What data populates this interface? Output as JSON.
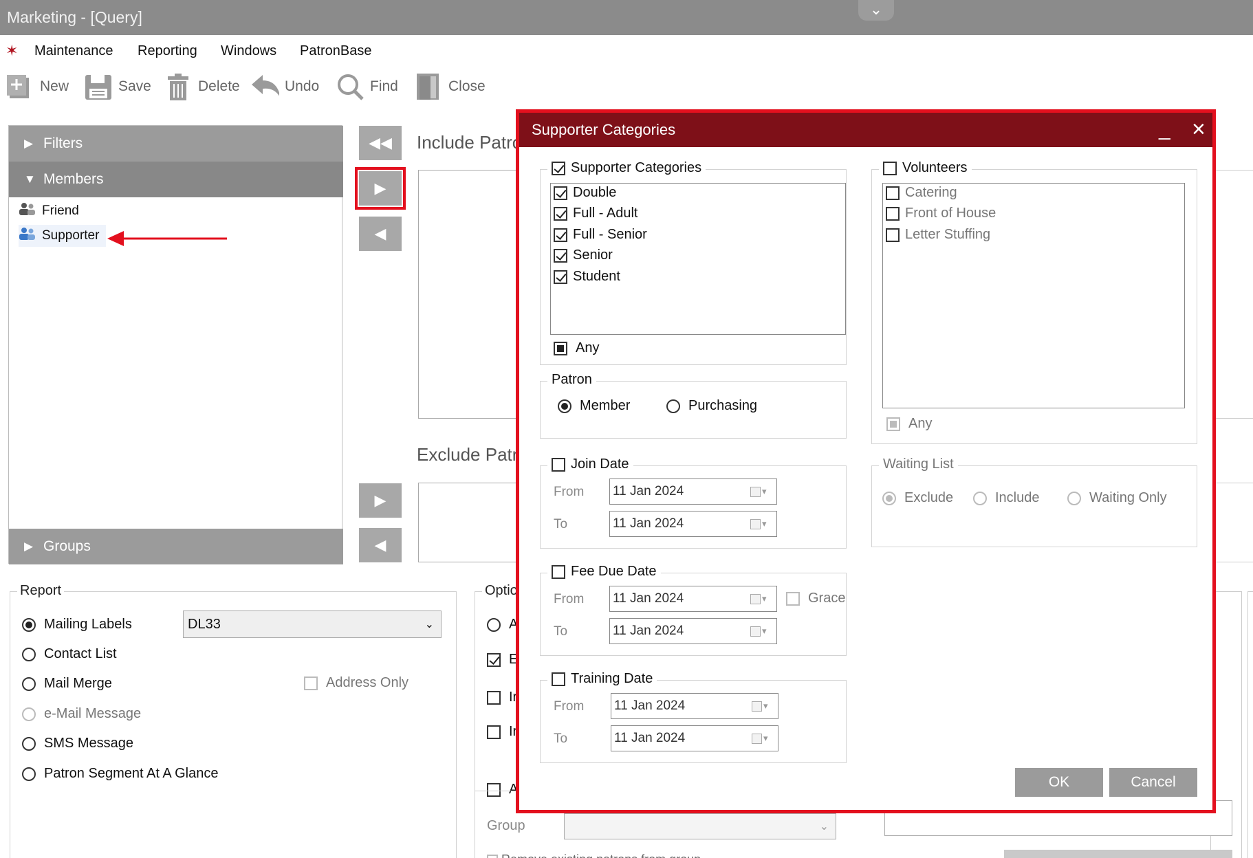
{
  "window": {
    "title": "Marketing - [Query]"
  },
  "menu": [
    "Maintenance",
    "Reporting",
    "Windows",
    "PatronBase"
  ],
  "toolbar": {
    "new": "New",
    "save": "Save",
    "delete": "Delete",
    "undo": "Undo",
    "find": "Find",
    "close": "Close"
  },
  "left_panel": {
    "filters": "Filters",
    "members": "Members",
    "groups": "Groups",
    "member_items": [
      "Friend",
      "Supporter"
    ]
  },
  "main": {
    "include_label": "Include Patro",
    "exclude_label": "Exclude Patro"
  },
  "report": {
    "title": "Report",
    "options": [
      "Mailing Labels",
      "Contact List",
      "Mail Merge",
      "e-Mail Message",
      "SMS Message",
      "Patron Segment At A Glance"
    ],
    "selected": "Mailing Labels",
    "label_format": "DL33",
    "address_only": "Address Only"
  },
  "options_panel": {
    "title": "Optio",
    "letters": [
      "A",
      "E",
      "Ir",
      "Ir",
      "A"
    ],
    "group_label": "Group",
    "remove_text": "Remove existing patrons from group"
  },
  "dialog": {
    "title": "Supporter Categories",
    "supporter_categories": {
      "label": "Supporter Categories",
      "checked": true,
      "items": [
        "Double",
        "Full - Adult",
        "Full - Senior",
        "Senior",
        "Student"
      ],
      "any": "Any"
    },
    "volunteers": {
      "label": "Volunteers",
      "checked": false,
      "items": [
        "Catering",
        "Front of House",
        "Letter Stuffing"
      ],
      "any": "Any"
    },
    "patron": {
      "label": "Patron",
      "options": [
        "Member",
        "Purchasing"
      ],
      "selected": "Member"
    },
    "join_date": {
      "label": "Join Date",
      "from_label": "From",
      "to_label": "To",
      "from": "11  Jan  2024",
      "to": "11  Jan  2024"
    },
    "fee_due_date": {
      "label": "Fee Due Date",
      "from_label": "From",
      "to_label": "To",
      "from": "11  Jan  2024",
      "to": "11  Jan  2024",
      "grace": "Grace"
    },
    "training_date": {
      "label": "Training Date",
      "from_label": "From",
      "to_label": "To",
      "from": "11  Jan  2024",
      "to": "11  Jan  2024"
    },
    "waiting_list": {
      "label": "Waiting List",
      "options": [
        "Exclude",
        "Include",
        "Waiting Only"
      ],
      "selected": "Exclude"
    },
    "ok": "OK",
    "cancel": "Cancel"
  },
  "colors": {
    "dialog_title_bg": "#7e1018",
    "highlight": "#e3101e",
    "titlebar_bg": "#8b8b8b"
  }
}
